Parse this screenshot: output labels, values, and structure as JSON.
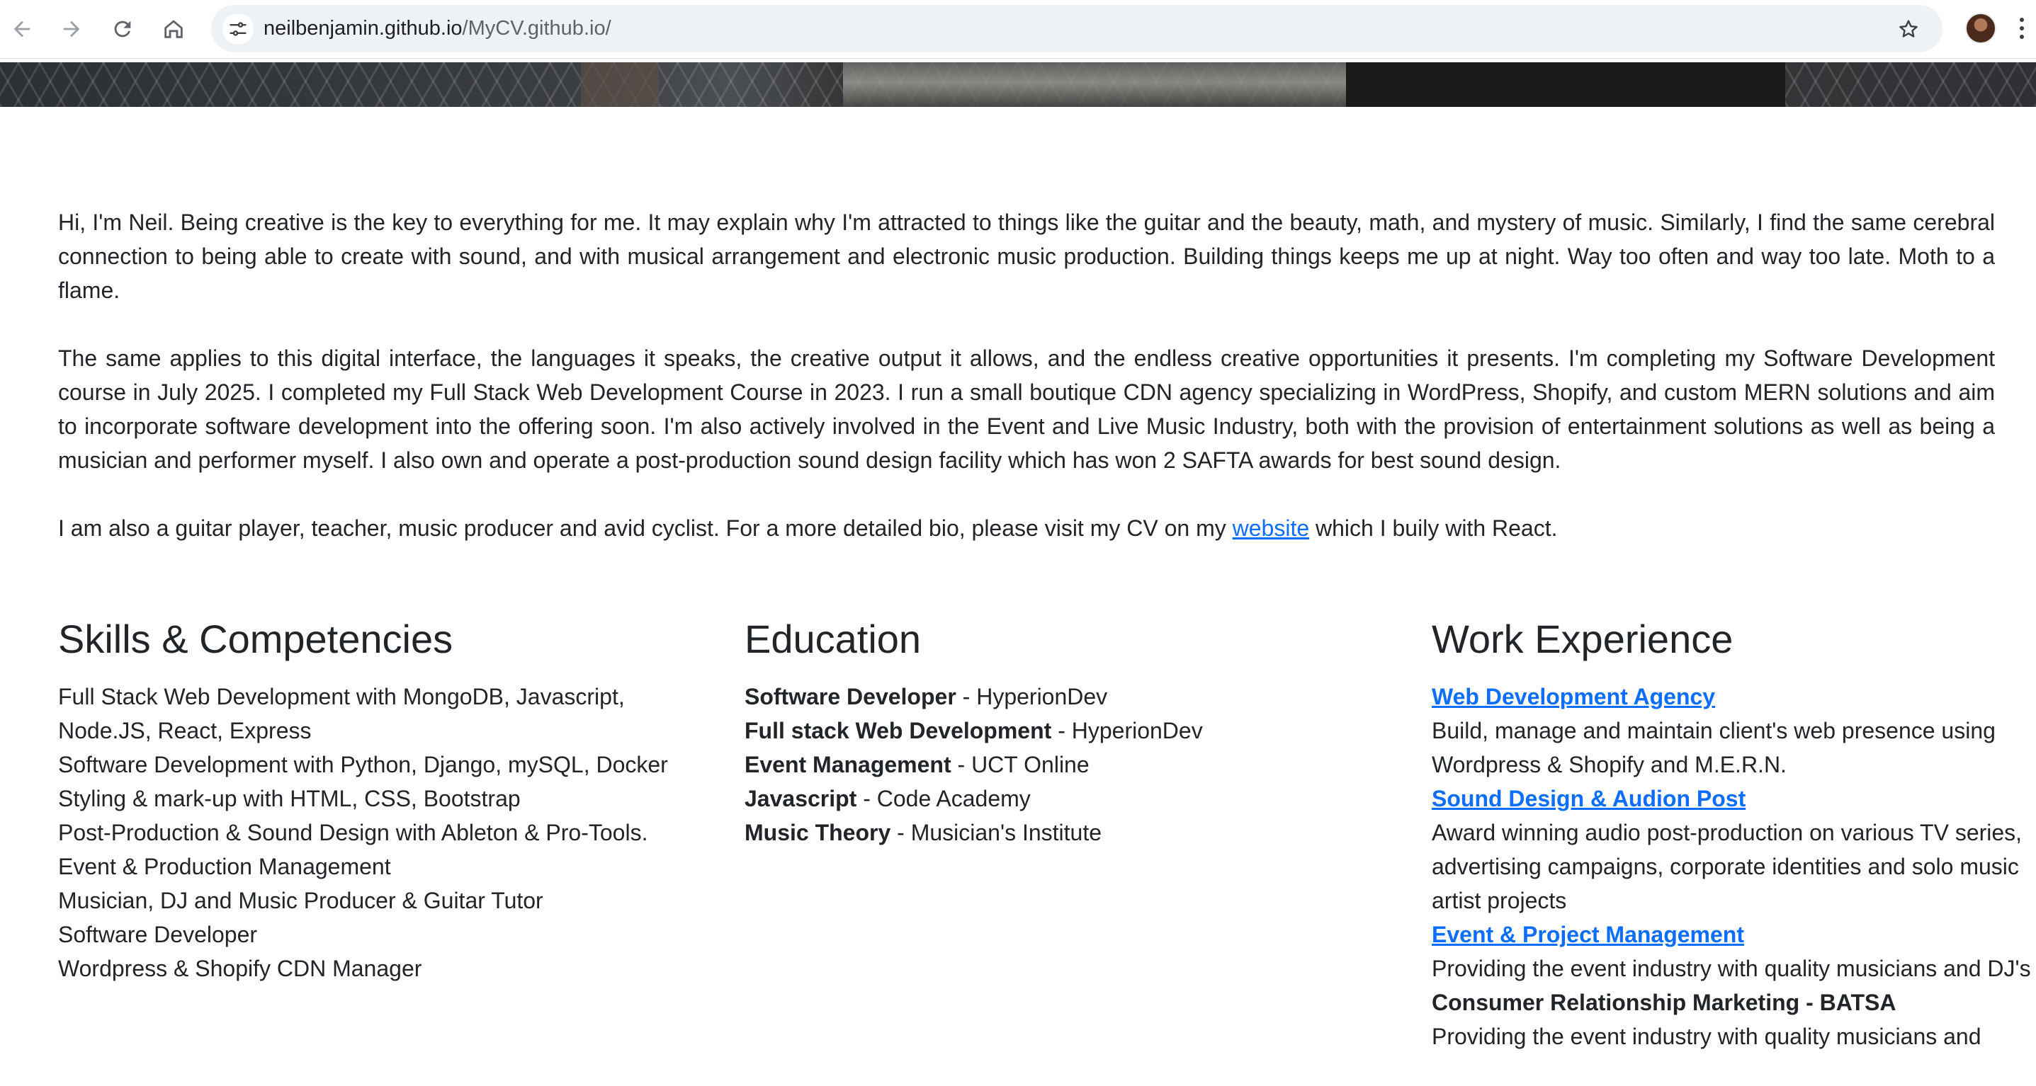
{
  "browser": {
    "url_host": "neilbenjamin.github.io",
    "url_path": "/MyCV.github.io/",
    "icons": [
      "back-arrow-icon",
      "forward-arrow-icon",
      "reload-icon",
      "home-icon",
      "site-info-icon",
      "star-icon",
      "profile-avatar",
      "kebab-menu-icon"
    ]
  },
  "bio": {
    "p1": "Hi, I'm Neil. Being creative is the key to everything for me. It may explain why I'm attracted to things like the guitar and the beauty, math, and mystery of music. Similarly, I find the same cerebral connection to being able to create with sound, and with musical arrangement and electronic music production. Building things keeps me up at night. Way too often and way too late. Moth to a flame.",
    "p2": "The same applies to this digital interface, the languages it speaks, the creative output it allows, and the endless creative opportunities it presents. I'm completing my Software Development course in July 2025. I completed my Full Stack Web Development Course in 2023. I run a small boutique CDN agency specializing in WordPress, Shopify, and custom MERN solutions and aim to incorporate software development into the offering soon. I'm also actively involved in the Event and Live Music Industry, both with the provision of entertainment solutions as well as being a musician and performer myself. I also own and operate a post-production sound design facility which has won 2 SAFTA awards for best sound design.",
    "p3_before": "I am also a guitar player, teacher, music producer and avid cyclist. For a more detailed bio, please visit my CV on my ",
    "p3_link": "website",
    "p3_after": " which I buily with React."
  },
  "skills": {
    "heading": "Skills & Competencies",
    "items": [
      "Full Stack Web Development with MongoDB, Javascript, Node.JS, React, Express",
      "Software Development with Python, Django, mySQL, Docker",
      "Styling & mark-up with HTML, CSS, Bootstrap",
      "Post-Production & Sound Design with Ableton & Pro-Tools.",
      "Event & Production Management",
      "Musician, DJ and Music Producer & Guitar Tutor",
      "Software Developer",
      "Wordpress & Shopify CDN Manager"
    ]
  },
  "education": {
    "heading": "Education",
    "items": [
      {
        "title": "Software Developer",
        "sep": " - ",
        "school": "HyperionDev"
      },
      {
        "title": "Full stack Web Development",
        "sep": " - ",
        "school": "HyperionDev"
      },
      {
        "title": "Event Management",
        "sep": " - ",
        "school": "UCT Online"
      },
      {
        "title": "Javascript",
        "sep": " - ",
        "school": "Code Academy"
      },
      {
        "title": "Music Theory",
        "sep": " - ",
        "school": "Musician's Institute"
      }
    ]
  },
  "work": {
    "heading": "Work Experience",
    "jobs": [
      {
        "title": "Web Development Agency",
        "desc": "Build, manage and maintain client's web presence using Wordpress & Shopify and M.E.R.N."
      },
      {
        "title": "Sound Design & Audion Post",
        "desc": "Award winning audio post-production on various TV series, advertising campaigns, corporate identities and solo music artist projects"
      },
      {
        "title": "Event & Project Management",
        "desc": "Providing the event industry with quality musicians and DJ's"
      },
      {
        "title": "Consumer Relationship Marketing - BATSA",
        "desc": "Providing the event industry with quality musicians and"
      }
    ]
  },
  "colors": {
    "link": "#0d6efd",
    "text": "#212529",
    "omnibox": "#eef1f6"
  }
}
